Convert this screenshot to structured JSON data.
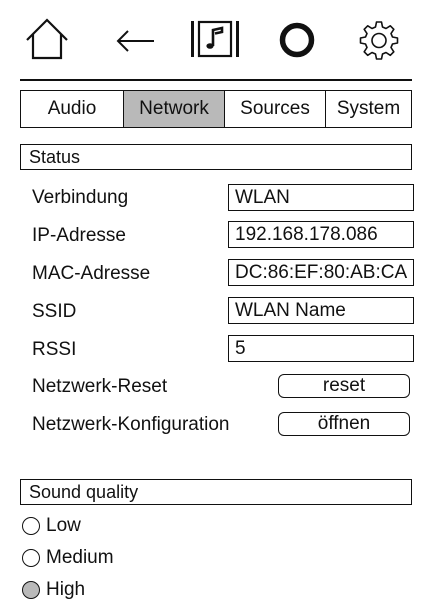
{
  "toolbar": {
    "buttons": [
      {
        "name": "home",
        "icon": "home-icon"
      },
      {
        "name": "back",
        "icon": "arrow-left-icon"
      },
      {
        "name": "now-playing",
        "icon": "music-note-icon"
      },
      {
        "name": "power",
        "icon": "ring-icon"
      },
      {
        "name": "settings",
        "icon": "gear-icon"
      }
    ]
  },
  "tabs": [
    {
      "label": "Audio",
      "active": false
    },
    {
      "label": "Network",
      "active": true
    },
    {
      "label": "Sources",
      "active": false
    },
    {
      "label": "System",
      "active": false
    }
  ],
  "status": {
    "heading": "Status",
    "connection": {
      "label": "Verbindung",
      "value": "WLAN"
    },
    "ip": {
      "label": "IP-Adresse",
      "value": "192.168.178.086"
    },
    "mac": {
      "label": "MAC-Adresse",
      "value": "DC:86:EF:80:AB:CA"
    },
    "ssid": {
      "label": "SSID",
      "value": "WLAN Name"
    },
    "rssi": {
      "label": "RSSI",
      "value": "5"
    },
    "reset": {
      "label": "Netzwerk-Reset",
      "button": "reset"
    },
    "config": {
      "label": "Netzwerk-Konfiguration",
      "button": "öffnen"
    }
  },
  "sound_quality": {
    "heading": "Sound quality",
    "options": [
      {
        "label": "Low",
        "selected": false
      },
      {
        "label": "Medium",
        "selected": false
      },
      {
        "label": "High",
        "selected": true
      }
    ]
  },
  "colors": {
    "active_tab": "#b9b9b9",
    "line": "#111111",
    "background": "#ffffff"
  }
}
